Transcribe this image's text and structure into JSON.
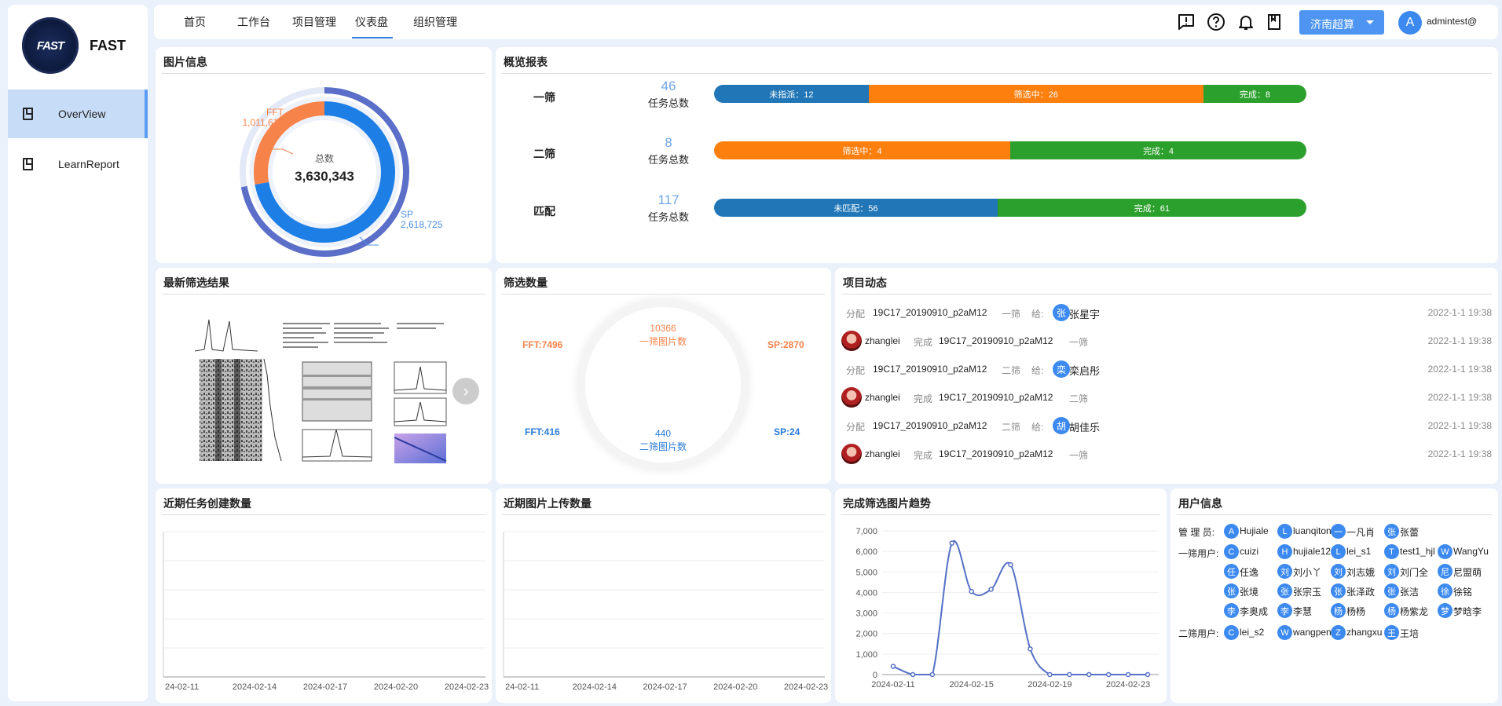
{
  "app": {
    "name": "FAST",
    "logo_text": "FAST"
  },
  "sidebar": {
    "items": [
      {
        "label": "OverView",
        "active": true
      },
      {
        "label": "LearnReport",
        "active": false
      }
    ]
  },
  "topbar": {
    "tabs": [
      {
        "label": "首页"
      },
      {
        "label": "工作台"
      },
      {
        "label": "项目管理"
      },
      {
        "label": "仪表盘",
        "active": true
      },
      {
        "label": "组织管理"
      }
    ],
    "region": "济南超算",
    "user_initial": "A",
    "username": "admintest@",
    "icons": [
      "feedback-icon",
      "help-icon",
      "bell-icon",
      "book-icon"
    ]
  },
  "image_info": {
    "title": "图片信息",
    "center_label": "总数",
    "total": "3,630,343",
    "fft_label": "FFT",
    "fft_value": "1,011,618",
    "sp_label": "SP",
    "sp_value": "2,618,725",
    "chart_data": {
      "type": "pie",
      "categories": [
        "FFT",
        "SP"
      ],
      "values": [
        1011618,
        2618725
      ],
      "colors": [
        "#f6834a",
        "#1d7fe6"
      ]
    }
  },
  "overview_report": {
    "title": "概览报表",
    "rows": [
      {
        "name": "一筛",
        "total": "46",
        "total_label": "任务总数",
        "segments": [
          {
            "label": "未指派：12",
            "value": 12,
            "color": "#2176b7"
          },
          {
            "label": "筛选中：26",
            "value": 26,
            "color": "#fd7f0e"
          },
          {
            "label": "完成：8",
            "value": 8,
            "color": "#2ca02c"
          }
        ]
      },
      {
        "name": "二筛",
        "total": "8",
        "total_label": "任务总数",
        "segments": [
          {
            "label": "筛选中：4",
            "value": 4,
            "color": "#fd7f0e"
          },
          {
            "label": "完成：4",
            "value": 4,
            "color": "#2ca02c"
          }
        ]
      },
      {
        "name": "匹配",
        "total": "117",
        "total_label": "任务总数",
        "segments": [
          {
            "label": "未匹配：56",
            "value": 56,
            "color": "#2176b7"
          },
          {
            "label": "完成：61",
            "value": 61,
            "color": "#2ca02c"
          }
        ]
      }
    ]
  },
  "latest_results": {
    "title": "最新筛选结果"
  },
  "screen_count": {
    "title": "筛选数量",
    "first_count": "10366",
    "first_label": "一筛图片数",
    "second_count": "440",
    "second_label": "二筛图片数",
    "fft_first": "FFT:7496",
    "sp_first": "SP:2870",
    "fft_second": "FFT:416",
    "sp_second": "SP:24"
  },
  "project_feed": {
    "title": "项目动态",
    "items": [
      {
        "kind": "assign",
        "action": "分配",
        "task": "19C17_20190910_p2aM12",
        "stage": "一筛",
        "to": "给:",
        "avatar": "张",
        "user": "张星宇",
        "time": "2022-1-1 19:38"
      },
      {
        "kind": "done",
        "user": "zhanglei",
        "action": "完成",
        "task": "19C17_20190910_p2aM12",
        "stage": "一筛",
        "time": "2022-1-1 19:38"
      },
      {
        "kind": "assign",
        "action": "分配",
        "task": "19C17_20190910_p2aM12",
        "stage": "二筛",
        "to": "给:",
        "avatar": "栾",
        "user": "栾启彤",
        "time": "2022-1-1 19:38"
      },
      {
        "kind": "done",
        "user": "zhanglei",
        "action": "完成",
        "task": "19C17_20190910_p2aM12",
        "stage": "二筛",
        "time": "2022-1-1 19:38"
      },
      {
        "kind": "assign",
        "action": "分配",
        "task": "19C17_20190910_p2aM12",
        "stage": "二筛",
        "to": "给:",
        "avatar": "胡",
        "user": "胡佳乐",
        "time": "2022-1-1 19:38"
      },
      {
        "kind": "done",
        "user": "zhanglei",
        "action": "完成",
        "task": "19C17_20190910_p2aM12",
        "stage": "一筛",
        "time": "2022-1-1 19:38"
      }
    ]
  },
  "recent_tasks": {
    "title": "近期任务创建数量",
    "chart_data": {
      "type": "line",
      "x": [
        "24-02-11",
        "2024-02-14",
        "2024-02-17",
        "2024-02-20",
        "2024-02-23"
      ],
      "series": []
    }
  },
  "recent_uploads": {
    "title": "近期图片上传数量",
    "chart_data": {
      "type": "line",
      "x": [
        "24-02-11",
        "2024-02-14",
        "2024-02-17",
        "2024-02-20",
        "2024-02-23"
      ],
      "series": []
    }
  },
  "trend": {
    "title": "完成筛选图片趋势",
    "chart_data": {
      "type": "line",
      "x": [
        "2024-02-11",
        "2024-02-12",
        "2024-02-13",
        "2024-02-14",
        "2024-02-15",
        "2024-02-16",
        "2024-02-17",
        "2024-02-18",
        "2024-02-19",
        "2024-02-20",
        "2024-02-21",
        "2024-02-22",
        "2024-02-23",
        "2024-02-24"
      ],
      "x_tick_labels": [
        "2024-02-11",
        "2024-02-15",
        "2024-02-19",
        "2024-02-23"
      ],
      "series": [
        {
          "values": [
            400,
            0,
            0,
            6400,
            4050,
            4150,
            5350,
            1250,
            0,
            0,
            0,
            0,
            0,
            0
          ]
        }
      ],
      "ylim": [
        0,
        7000
      ],
      "yticks": [
        "0",
        "1,000",
        "2,000",
        "3,000",
        "4,000",
        "5,000",
        "6,000",
        "7,000"
      ],
      "color": "#5470c6"
    }
  },
  "users": {
    "title": "用户信息",
    "admin_label": "管 理 员:",
    "admins": [
      [
        "A",
        "Hujiale"
      ],
      [
        "L",
        "luanqitong"
      ],
      [
        "一",
        "一凡肖"
      ],
      [
        "张",
        "张蕾"
      ]
    ],
    "first_label": "一筛用户:",
    "first": [
      [
        "C",
        "cuizi"
      ],
      [
        "H",
        "hujiale123"
      ],
      [
        "L",
        "lei_s1"
      ],
      [
        "T",
        "test1_hjl"
      ],
      [
        "W",
        "WangYu"
      ],
      [
        "任",
        "任逸"
      ],
      [
        "刘",
        "刘小丫"
      ],
      [
        "刘",
        "刘志娥"
      ],
      [
        "刘",
        "刘门全"
      ],
      [
        "尼",
        "尼盟萌"
      ],
      [
        "张",
        "张境"
      ],
      [
        "张",
        "张宗玉"
      ],
      [
        "张",
        "张泽政"
      ],
      [
        "张",
        "张洁"
      ],
      [
        "徐",
        "徐铭"
      ],
      [
        "李",
        "李奥成"
      ],
      [
        "李",
        "李慧"
      ],
      [
        "杨",
        "杨杨"
      ],
      [
        "杨",
        "杨紫龙"
      ],
      [
        "梦",
        "梦晗李"
      ]
    ],
    "second_label": "二筛用户:",
    "second": [
      [
        "C",
        "lei_s2"
      ],
      [
        "W",
        "wangpeng"
      ],
      [
        "Z",
        "zhangxu"
      ],
      [
        "王",
        "王培"
      ]
    ]
  }
}
